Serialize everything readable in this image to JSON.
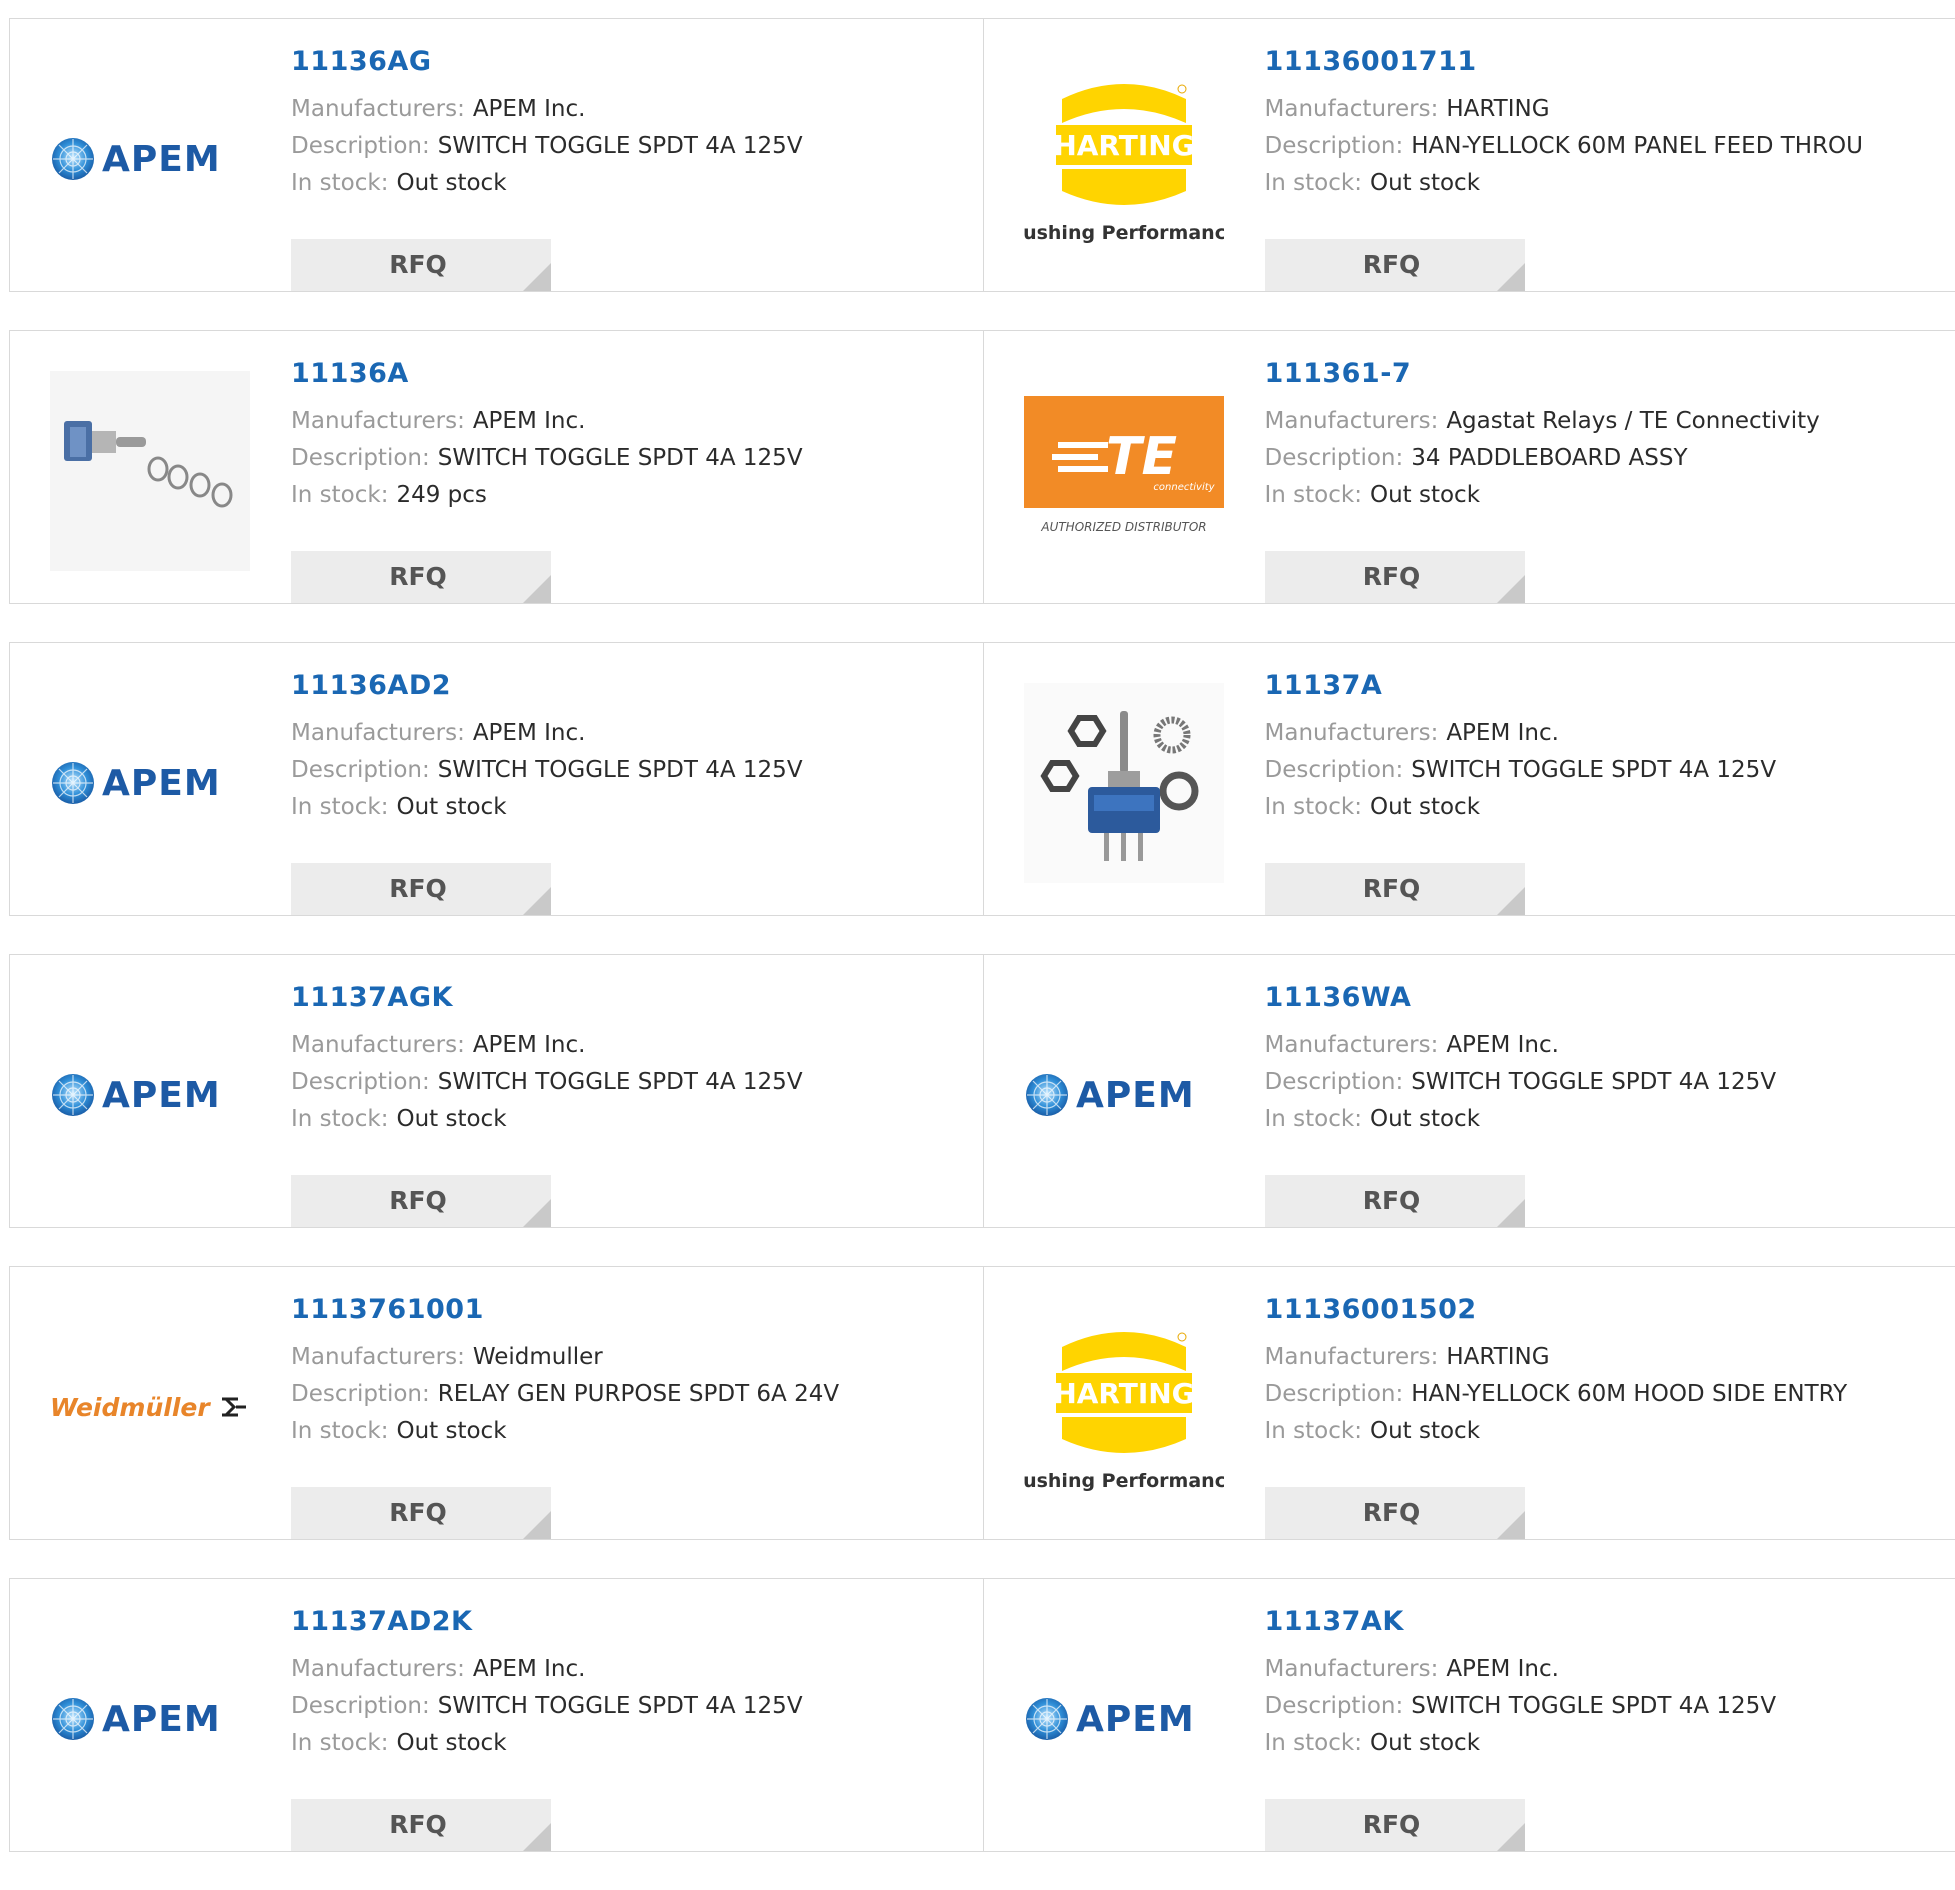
{
  "labels": {
    "manufacturers": "Manufacturers:",
    "description": "Description:",
    "in_stock": "In stock:",
    "rfq": "RFQ"
  },
  "logos": {
    "apem": {
      "text": "APEM",
      "color": "#1d5aa5"
    },
    "harting": {
      "text": "HARTING",
      "tagline": "Pushing Performance",
      "color": "#ffd400"
    },
    "te": {
      "text": "TE",
      "sub": "connectivity",
      "tagline": "AUTHORIZED DISTRIBUTOR",
      "color": "#f28b26"
    },
    "weidmuller": {
      "text": "Weidmüller",
      "color": "#e8852a"
    }
  },
  "products": [
    {
      "pn": "11136AG",
      "manufacturer": "APEM Inc.",
      "description": "SWITCH TOGGLE SPDT 4A 125V",
      "stock": "Out stock",
      "logo": "apem"
    },
    {
      "pn": "11136001711",
      "manufacturer": "HARTING",
      "description": "HAN-YELLOCK 60M PANEL FEED THROU",
      "stock": "Out stock",
      "logo": "harting"
    },
    {
      "pn": "11136A",
      "manufacturer": "APEM Inc.",
      "description": "SWITCH TOGGLE SPDT 4A 125V",
      "stock": "249 pcs",
      "logo": "switch-photo"
    },
    {
      "pn": "111361-7",
      "manufacturer": "Agastat Relays / TE Connectivity",
      "description": "34 PADDLEBOARD ASSY",
      "stock": "Out stock",
      "logo": "te"
    },
    {
      "pn": "11136AD2",
      "manufacturer": "APEM Inc.",
      "description": "SWITCH TOGGLE SPDT 4A 125V",
      "stock": "Out stock",
      "logo": "apem"
    },
    {
      "pn": "11137A",
      "manufacturer": "APEM Inc.",
      "description": "SWITCH TOGGLE SPDT 4A 125V",
      "stock": "Out stock",
      "logo": "switch-nuts-photo"
    },
    {
      "pn": "11137AGK",
      "manufacturer": "APEM Inc.",
      "description": "SWITCH TOGGLE SPDT 4A 125V",
      "stock": "Out stock",
      "logo": "apem"
    },
    {
      "pn": "11136WA",
      "manufacturer": "APEM Inc.",
      "description": "SWITCH TOGGLE SPDT 4A 125V",
      "stock": "Out stock",
      "logo": "apem"
    },
    {
      "pn": "1113761001",
      "manufacturer": "Weidmuller",
      "description": "RELAY GEN PURPOSE SPDT 6A 24V",
      "stock": "Out stock",
      "logo": "weidmuller"
    },
    {
      "pn": "11136001502",
      "manufacturer": "HARTING",
      "description": "HAN-YELLOCK 60M HOOD SIDE ENTRY",
      "stock": "Out stock",
      "logo": "harting"
    },
    {
      "pn": "11137AD2K",
      "manufacturer": "APEM Inc.",
      "description": "SWITCH TOGGLE SPDT 4A 125V",
      "stock": "Out stock",
      "logo": "apem"
    },
    {
      "pn": "11137AK",
      "manufacturer": "APEM Inc.",
      "description": "SWITCH TOGGLE SPDT 4A 125V",
      "stock": "Out stock",
      "logo": "apem"
    }
  ]
}
